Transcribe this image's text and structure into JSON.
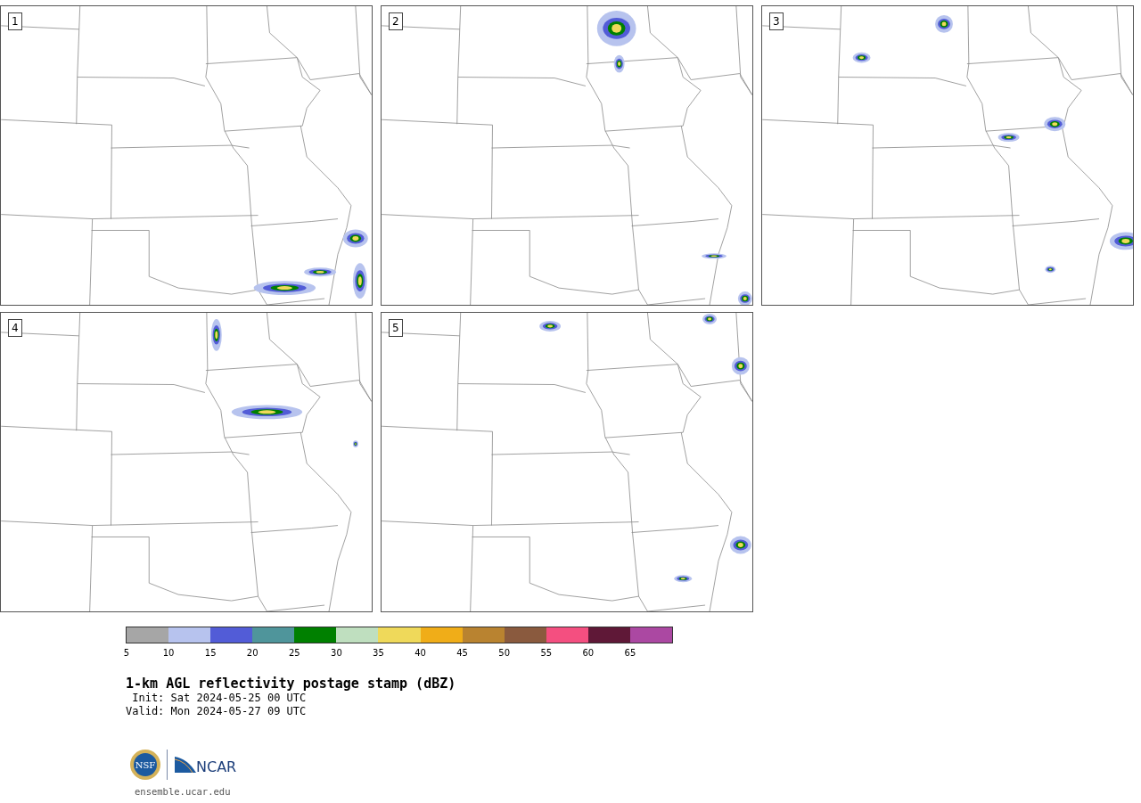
{
  "panels": [
    {
      "label": "1"
    },
    {
      "label": "2"
    },
    {
      "label": "3"
    },
    {
      "label": "4"
    },
    {
      "label": "5"
    }
  ],
  "colorbar": {
    "bins": [
      {
        "tick": "5",
        "color": "#a6a6a6"
      },
      {
        "tick": "10",
        "color": "#b7c3ee"
      },
      {
        "tick": "15",
        "color": "#525cd7"
      },
      {
        "tick": "20",
        "color": "#4f959b"
      },
      {
        "tick": "25",
        "color": "#008000"
      },
      {
        "tick": "30",
        "color": "#bfdfbf"
      },
      {
        "tick": "35",
        "color": "#efd95a"
      },
      {
        "tick": "40",
        "color": "#f0ad18"
      },
      {
        "tick": "45",
        "color": "#b98330"
      },
      {
        "tick": "50",
        "color": "#8a5a3e"
      },
      {
        "tick": "55",
        "color": "#f44f80"
      },
      {
        "tick": "60",
        "color": "#5f1837"
      },
      {
        "tick": "65",
        "color": "#ab48a2"
      }
    ]
  },
  "title": "1-km AGL reflectivity postage stamp (dBZ)",
  "init": " Init: Sat 2024-05-25 00 UTC",
  "valid": "Valid: Mon 2024-05-27 09 UTC",
  "logos": {
    "nsf": "NSF",
    "ncar": "NCAR"
  },
  "url": "ensemble.ucar.edu"
}
